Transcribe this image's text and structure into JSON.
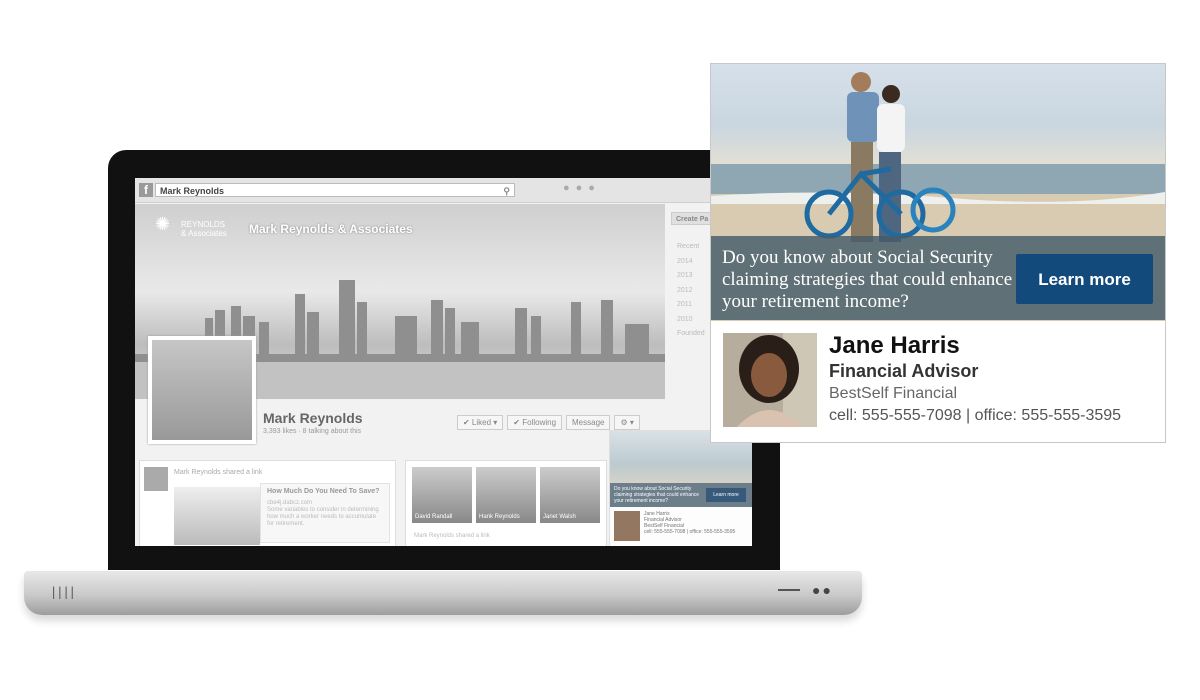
{
  "facebook": {
    "search_value": "Mark Reynolds",
    "search_icon": "search-icon",
    "cover_logo_line1": "REYNOLDS",
    "cover_logo_line2": "& Associates",
    "cover_title": "Mark Reynolds & Associates",
    "profile_name": "Mark Reynolds",
    "profile_stats": "3,393 likes · 8 talking about this",
    "buttons": {
      "liked": "✔ Liked ▾",
      "following": "✔ Following",
      "message": "Message",
      "gear": "⚙ ▾"
    },
    "right_create": "Create Pa",
    "right_years": [
      "Recent",
      "2014",
      "2013",
      "2012",
      "2011",
      "2010",
      "Founded"
    ],
    "post_left": {
      "header": "Mark Reynolds shared a link",
      "title": "How Much Do You Need To Save?",
      "url": "cbe4j.dabcz.com",
      "body": "Some variables to consider in determining how much a worker needs to accumulate for retirement."
    },
    "friends": [
      "David Randall",
      "Hank Reynolds",
      "Janet Walsh"
    ],
    "post_right_footer": "Mark Reynolds shared a link",
    "mini_ad": {
      "question": "Do you know about Social Security claiming strategies that could enhance your retirement income?",
      "button": "Learn more",
      "name": "Jane Harris",
      "title": "Financial Advisor",
      "company": "BestSelf Financial",
      "contact": "cell: 555-555-7098 | office: 555-555-3595"
    }
  },
  "ad": {
    "question": "Do you know about Social Security claiming strategies that could enhance your retirement income?",
    "cta_label": "Learn more",
    "agent": {
      "name": "Jane Harris",
      "title": "Financial Advisor",
      "company": "BestSelf Financial",
      "contact": "cell: 555-555-7098 | office: 555-555-3595"
    }
  },
  "colors": {
    "cta": "#134a7c",
    "banner": "#465c6a",
    "laptop_bezel": "#111111"
  }
}
